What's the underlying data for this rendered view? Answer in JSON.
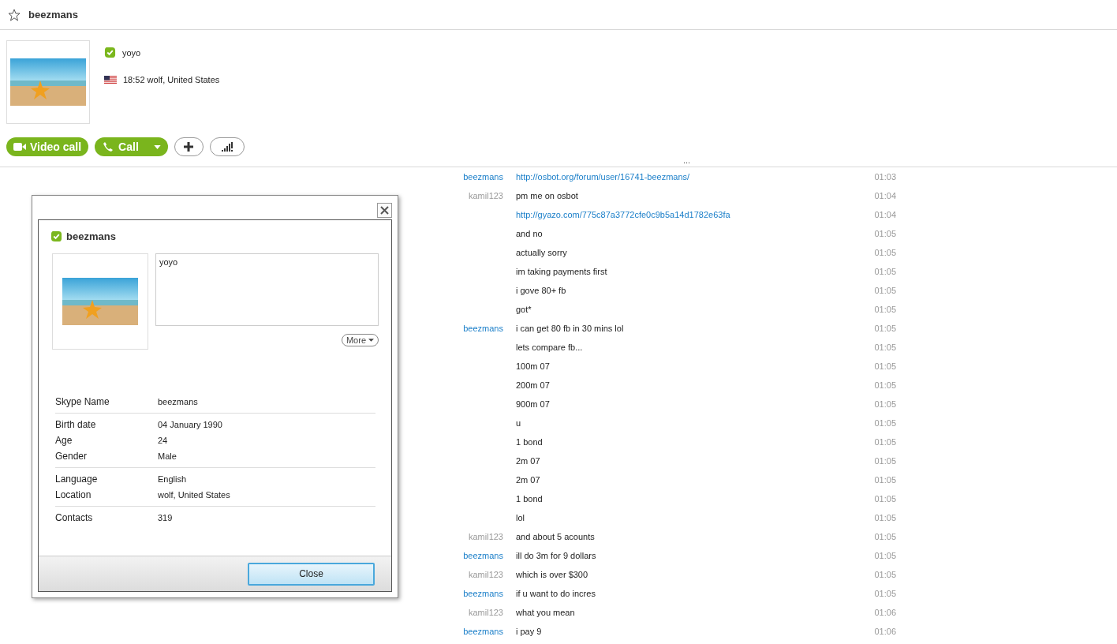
{
  "header": {
    "title": "beezmans",
    "favorite": false
  },
  "profile": {
    "mood": "yoyo",
    "local_info": "18:52 wolf, United States"
  },
  "actions": [
    {
      "kind": "video",
      "label": "Video call"
    },
    {
      "kind": "call",
      "label": "Call"
    },
    {
      "kind": "add"
    },
    {
      "kind": "signal"
    }
  ],
  "divider_handle": "...",
  "chat": [
    {
      "sender": "beezmans",
      "from_contact": true,
      "text": "http://osbot.org/forum/user/16741-beezmans/",
      "kind": "link",
      "time": "01:03"
    },
    {
      "sender": "kamil123",
      "from_contact": false,
      "text": "pm me on osbot",
      "kind": "text",
      "time": "01:04"
    },
    {
      "text": "http://gyazo.com/775c87a3772cfe0c9b5a14d1782e63fa",
      "kind": "link",
      "time": "01:04"
    },
    {
      "text": "and no",
      "kind": "text",
      "time": "01:05"
    },
    {
      "text": "actually sorry",
      "kind": "text",
      "time": "01:05"
    },
    {
      "text": "im taking payments first",
      "kind": "text",
      "time": "01:05"
    },
    {
      "text": "i gove 80+ fb",
      "kind": "text",
      "time": "01:05"
    },
    {
      "text": "got*",
      "kind": "text",
      "time": "01:05"
    },
    {
      "sender": "beezmans",
      "from_contact": true,
      "text": "i can get 80 fb in 30 mins lol",
      "kind": "text",
      "time": "01:05"
    },
    {
      "text": "lets compare fb...",
      "kind": "text",
      "time": "01:05"
    },
    {
      "text": "100m 07",
      "kind": "text",
      "time": "01:05"
    },
    {
      "text": "200m 07",
      "kind": "text",
      "time": "01:05"
    },
    {
      "text": "900m 07",
      "kind": "text",
      "time": "01:05"
    },
    {
      "text": "u",
      "kind": "text",
      "time": "01:05"
    },
    {
      "text": "1 bond",
      "kind": "text",
      "time": "01:05"
    },
    {
      "text": "2m 07",
      "kind": "text",
      "time": "01:05"
    },
    {
      "text": "2m 07",
      "kind": "text",
      "time": "01:05"
    },
    {
      "text": "1 bond",
      "kind": "text",
      "time": "01:05"
    },
    {
      "text": "lol",
      "kind": "text",
      "time": "01:05"
    },
    {
      "sender": "kamil123",
      "from_contact": false,
      "text": "and about 5 acounts",
      "kind": "text",
      "time": "01:05"
    },
    {
      "sender": "beezmans",
      "from_contact": true,
      "text": "ill do 3m for 9 dollars",
      "kind": "text",
      "time": "01:05"
    },
    {
      "sender": "kamil123",
      "from_contact": false,
      "text": "which is over $300",
      "kind": "text",
      "time": "01:05"
    },
    {
      "sender": "beezmans",
      "from_contact": true,
      "text": "if u want to do incres",
      "kind": "text",
      "time": "01:05"
    },
    {
      "sender": "kamil123",
      "from_contact": false,
      "text": "what you mean",
      "kind": "text",
      "time": "01:06"
    },
    {
      "sender": "beezmans",
      "from_contact": true,
      "text": "i pay 9",
      "kind": "text",
      "time": "01:06"
    }
  ],
  "dialog": {
    "name": "beezmans",
    "mood": "yoyo",
    "more_button": "More",
    "info_groups": [
      [
        {
          "label": "Skype Name",
          "value": "beezmans"
        }
      ],
      [
        {
          "label": "Birth date",
          "value": "04 January 1990"
        },
        {
          "label": "Age",
          "value": "24"
        },
        {
          "label": "Gender",
          "value": "Male"
        }
      ],
      [
        {
          "label": "Language",
          "value": "English"
        },
        {
          "label": "Location",
          "value": "wolf, United States"
        }
      ],
      [
        {
          "label": "Contacts",
          "value": "319"
        }
      ]
    ],
    "close_button": "Close"
  }
}
